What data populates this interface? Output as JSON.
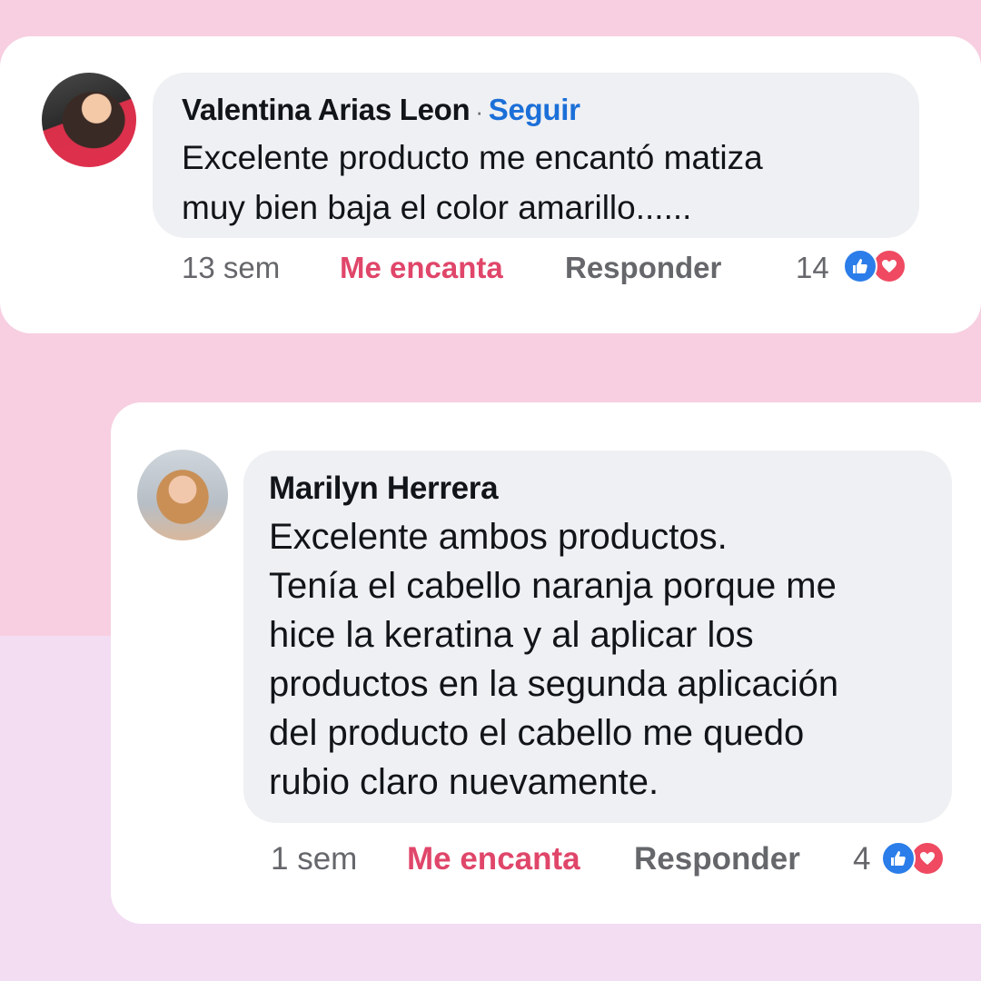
{
  "colors": {
    "background_top": "#f7cfe0",
    "background_bottom": "#f3ddf3",
    "bubble": "#eff0f3",
    "follow_link": "#1b6fd8",
    "love_action": "#e0466a",
    "like_reaction": "#2b7de9",
    "heart_reaction": "#ef4a62"
  },
  "comments": [
    {
      "author": "Valentina Arias Leon",
      "separator": "·",
      "follow_label": "Seguir",
      "text": "Excelente producto me encantó matiza\nmuy bien baja el color amarillo......",
      "time": "13 sem",
      "reaction_label": "Me encanta",
      "reply_label": "Responder",
      "reaction_count": "14",
      "reaction_icons": [
        "like-icon",
        "heart-icon"
      ]
    },
    {
      "author": "Marilyn Herrera",
      "text": "Excelente ambos productos.\nTenía el cabello naranja porque me\nhice la keratina y al aplicar los\nproductos en la segunda aplicación\ndel producto el cabello me quedo\nrubio claro nuevamente.",
      "time": "1 sem",
      "reaction_label": "Me encanta",
      "reply_label": "Responder",
      "reaction_count": "4",
      "reaction_icons": [
        "like-icon",
        "heart-icon"
      ]
    }
  ]
}
